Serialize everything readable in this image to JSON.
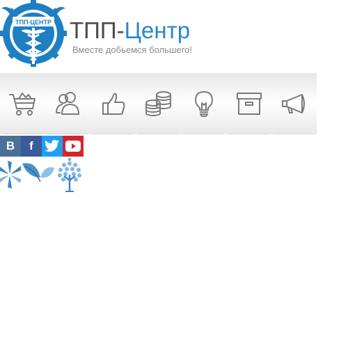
{
  "header": {
    "logo": {
      "text": "ТПП-ЦЕНТР",
      "icon": "gear-caduceus-logo",
      "color": "#1e7fc3"
    },
    "title_part1": "ТПП-",
    "title_part2": "Центр",
    "tagline": "Вместе добьемся большего!"
  },
  "nav_icons": [
    {
      "icon": "shopping-cart-icon"
    },
    {
      "icon": "users-icon"
    },
    {
      "icon": "thumbs-up-icon"
    },
    {
      "icon": "coins-stack-icon"
    },
    {
      "icon": "lightbulb-icon"
    },
    {
      "icon": "archive-box-icon"
    },
    {
      "icon": "megaphone-icon"
    }
  ],
  "social": [
    {
      "name": "vk",
      "letter": "В",
      "color": "#4b6f98"
    },
    {
      "name": "facebook",
      "letter": "f",
      "color": "#3b5a99"
    },
    {
      "name": "twitter",
      "icon": "twitter-bird-icon",
      "color": "#1da0f2"
    },
    {
      "name": "youtube",
      "icon": "youtube-play-icon",
      "color": "#d4252b"
    }
  ],
  "partners": [
    {
      "icon": "pinwheel-logo-icon"
    },
    {
      "icon": "leaves-logo-icon"
    },
    {
      "icon": "tree-logo-icon"
    }
  ],
  "colors": {
    "accent": "#2b87c8",
    "text_dark": "#4a4a4a",
    "tagline": "#8a8a8a",
    "icon_gray": "#7a7a7a"
  }
}
